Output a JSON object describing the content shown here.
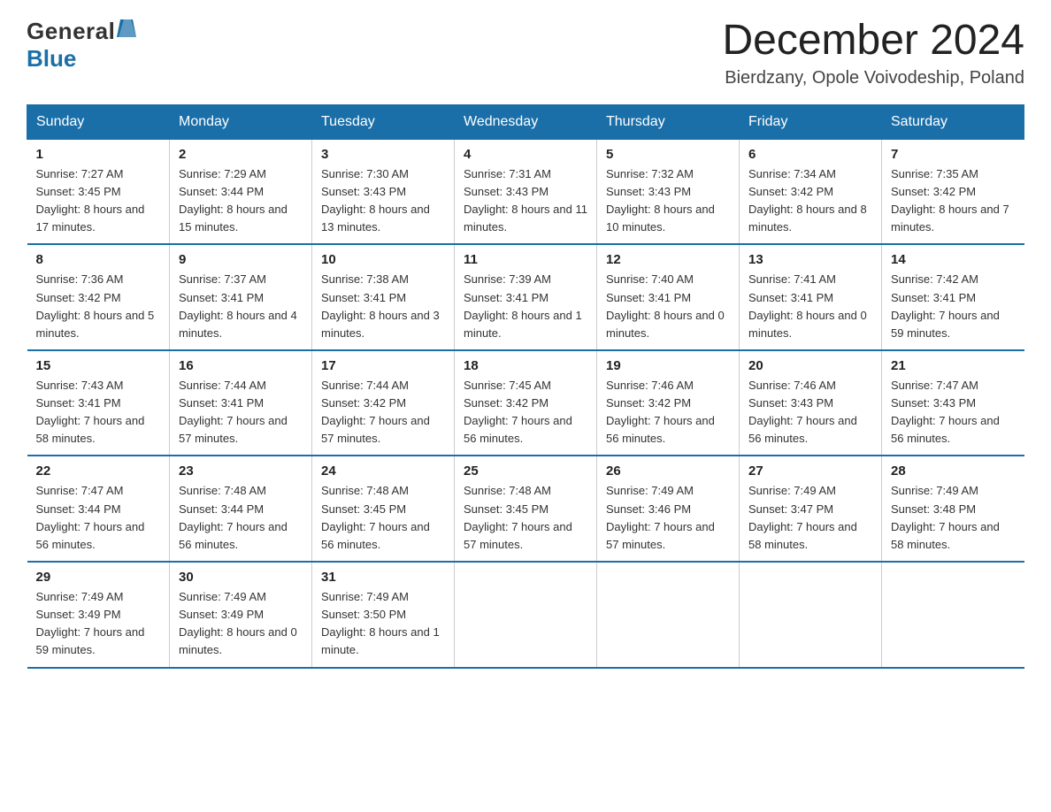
{
  "logo": {
    "general": "General",
    "blue": "Blue"
  },
  "header": {
    "month": "December 2024",
    "location": "Bierdzany, Opole Voivodeship, Poland"
  },
  "weekdays": [
    "Sunday",
    "Monday",
    "Tuesday",
    "Wednesday",
    "Thursday",
    "Friday",
    "Saturday"
  ],
  "weeks": [
    [
      {
        "day": "1",
        "sunrise": "7:27 AM",
        "sunset": "3:45 PM",
        "daylight": "8 hours and 17 minutes."
      },
      {
        "day": "2",
        "sunrise": "7:29 AM",
        "sunset": "3:44 PM",
        "daylight": "8 hours and 15 minutes."
      },
      {
        "day": "3",
        "sunrise": "7:30 AM",
        "sunset": "3:43 PM",
        "daylight": "8 hours and 13 minutes."
      },
      {
        "day": "4",
        "sunrise": "7:31 AM",
        "sunset": "3:43 PM",
        "daylight": "8 hours and 11 minutes."
      },
      {
        "day": "5",
        "sunrise": "7:32 AM",
        "sunset": "3:43 PM",
        "daylight": "8 hours and 10 minutes."
      },
      {
        "day": "6",
        "sunrise": "7:34 AM",
        "sunset": "3:42 PM",
        "daylight": "8 hours and 8 minutes."
      },
      {
        "day": "7",
        "sunrise": "7:35 AM",
        "sunset": "3:42 PM",
        "daylight": "8 hours and 7 minutes."
      }
    ],
    [
      {
        "day": "8",
        "sunrise": "7:36 AM",
        "sunset": "3:42 PM",
        "daylight": "8 hours and 5 minutes."
      },
      {
        "day": "9",
        "sunrise": "7:37 AM",
        "sunset": "3:41 PM",
        "daylight": "8 hours and 4 minutes."
      },
      {
        "day": "10",
        "sunrise": "7:38 AM",
        "sunset": "3:41 PM",
        "daylight": "8 hours and 3 minutes."
      },
      {
        "day": "11",
        "sunrise": "7:39 AM",
        "sunset": "3:41 PM",
        "daylight": "8 hours and 1 minute."
      },
      {
        "day": "12",
        "sunrise": "7:40 AM",
        "sunset": "3:41 PM",
        "daylight": "8 hours and 0 minutes."
      },
      {
        "day": "13",
        "sunrise": "7:41 AM",
        "sunset": "3:41 PM",
        "daylight": "8 hours and 0 minutes."
      },
      {
        "day": "14",
        "sunrise": "7:42 AM",
        "sunset": "3:41 PM",
        "daylight": "7 hours and 59 minutes."
      }
    ],
    [
      {
        "day": "15",
        "sunrise": "7:43 AM",
        "sunset": "3:41 PM",
        "daylight": "7 hours and 58 minutes."
      },
      {
        "day": "16",
        "sunrise": "7:44 AM",
        "sunset": "3:41 PM",
        "daylight": "7 hours and 57 minutes."
      },
      {
        "day": "17",
        "sunrise": "7:44 AM",
        "sunset": "3:42 PM",
        "daylight": "7 hours and 57 minutes."
      },
      {
        "day": "18",
        "sunrise": "7:45 AM",
        "sunset": "3:42 PM",
        "daylight": "7 hours and 56 minutes."
      },
      {
        "day": "19",
        "sunrise": "7:46 AM",
        "sunset": "3:42 PM",
        "daylight": "7 hours and 56 minutes."
      },
      {
        "day": "20",
        "sunrise": "7:46 AM",
        "sunset": "3:43 PM",
        "daylight": "7 hours and 56 minutes."
      },
      {
        "day": "21",
        "sunrise": "7:47 AM",
        "sunset": "3:43 PM",
        "daylight": "7 hours and 56 minutes."
      }
    ],
    [
      {
        "day": "22",
        "sunrise": "7:47 AM",
        "sunset": "3:44 PM",
        "daylight": "7 hours and 56 minutes."
      },
      {
        "day": "23",
        "sunrise": "7:48 AM",
        "sunset": "3:44 PM",
        "daylight": "7 hours and 56 minutes."
      },
      {
        "day": "24",
        "sunrise": "7:48 AM",
        "sunset": "3:45 PM",
        "daylight": "7 hours and 56 minutes."
      },
      {
        "day": "25",
        "sunrise": "7:48 AM",
        "sunset": "3:45 PM",
        "daylight": "7 hours and 57 minutes."
      },
      {
        "day": "26",
        "sunrise": "7:49 AM",
        "sunset": "3:46 PM",
        "daylight": "7 hours and 57 minutes."
      },
      {
        "day": "27",
        "sunrise": "7:49 AM",
        "sunset": "3:47 PM",
        "daylight": "7 hours and 58 minutes."
      },
      {
        "day": "28",
        "sunrise": "7:49 AM",
        "sunset": "3:48 PM",
        "daylight": "7 hours and 58 minutes."
      }
    ],
    [
      {
        "day": "29",
        "sunrise": "7:49 AM",
        "sunset": "3:49 PM",
        "daylight": "7 hours and 59 minutes."
      },
      {
        "day": "30",
        "sunrise": "7:49 AM",
        "sunset": "3:49 PM",
        "daylight": "8 hours and 0 minutes."
      },
      {
        "day": "31",
        "sunrise": "7:49 AM",
        "sunset": "3:50 PM",
        "daylight": "8 hours and 1 minute."
      },
      null,
      null,
      null,
      null
    ]
  ]
}
